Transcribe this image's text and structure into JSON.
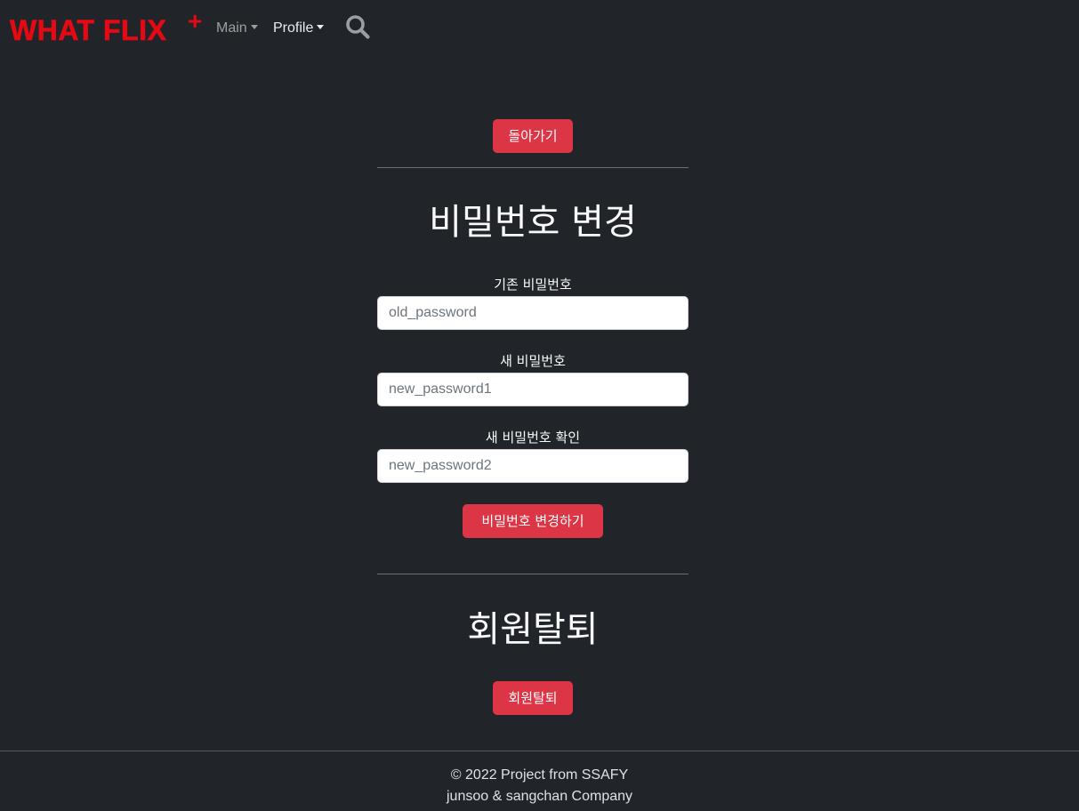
{
  "navbar": {
    "brand": "WHAT FLIX",
    "brand_plus": "+",
    "menu": [
      {
        "label": "Main"
      },
      {
        "label": "Profile"
      }
    ],
    "search_icon": "search-icon"
  },
  "back_button": "돌아가기",
  "password_section": {
    "title": "비밀번호 변경",
    "fields": [
      {
        "label": "기존 비밀번호",
        "placeholder": "old_password",
        "value": ""
      },
      {
        "label": "새 비밀번호",
        "placeholder": "new_password1",
        "value": ""
      },
      {
        "label": "새 비밀번호 확인",
        "placeholder": "new_password2",
        "value": ""
      }
    ],
    "submit_label": "비밀번호 변경하기"
  },
  "withdraw_section": {
    "title": "회원탈퇴",
    "button_label": "회원탈퇴"
  },
  "footer": {
    "line1": "© 2022 Project from SSAFY",
    "line2": "junsoo & sangchan Company"
  },
  "colors": {
    "background": "#212529",
    "accent": "#dc3545",
    "brand": "#e50914"
  }
}
